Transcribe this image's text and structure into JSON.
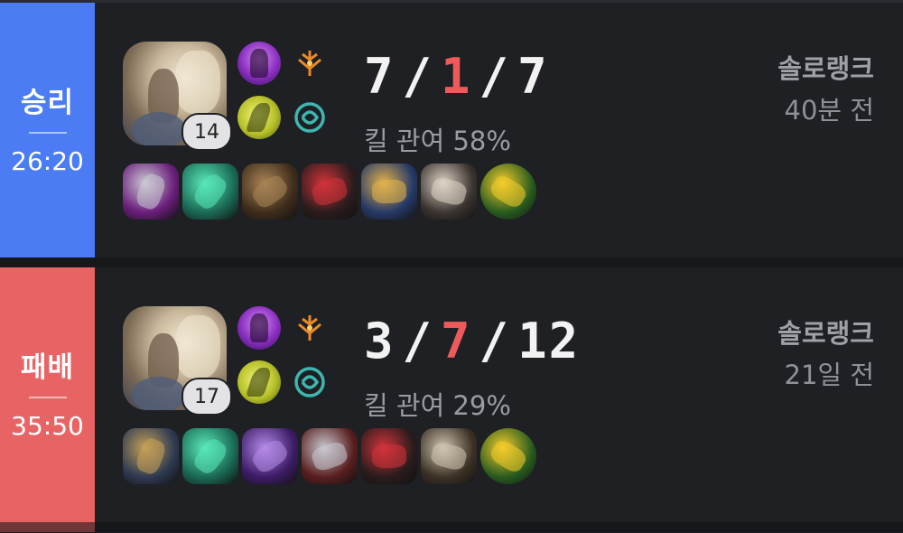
{
  "matches": [
    {
      "result": "승리",
      "duration": "26:20",
      "result_color": "#4b7cf3",
      "champion_level": "14",
      "kda": {
        "kills": "7",
        "deaths": "1",
        "assists": "7"
      },
      "kill_participation": "킬 관여 58%",
      "queue": "솔로랭크",
      "time_ago": "40분 전",
      "spells": [
        "ghost-spell-icon",
        "ignite-spell-icon"
      ],
      "runes": [
        "precision-keystone-icon",
        "sorcery-secondary-icon"
      ],
      "items": [
        {
          "name": "dagger-item-icon",
          "color": "#6a1e7a",
          "accent": "#c9c9d2"
        },
        {
          "name": "potion-item-icon",
          "color": "#1b6a55",
          "accent": "#58e8b8"
        },
        {
          "name": "boots-item-icon",
          "color": "#3f2d1c",
          "accent": "#a98555"
        },
        {
          "name": "black-cleaver-item-icon",
          "color": "#2a1c1c",
          "accent": "#d1333a"
        },
        {
          "name": "spear-item-icon",
          "color": "#263a68",
          "accent": "#e2b24a"
        },
        {
          "name": "armor-item-icon",
          "color": "#3b3430",
          "accent": "#ddd3c5"
        },
        {
          "name": "oracle-lens-trinket-icon",
          "color": "#275a1f",
          "accent": "#f3cc2a"
        }
      ]
    },
    {
      "result": "패배",
      "duration": "35:50",
      "result_color": "#e86464",
      "champion_level": "17",
      "kda": {
        "kills": "3",
        "deaths": "7",
        "assists": "12"
      },
      "kill_participation": "킬 관여 29%",
      "queue": "솔로랭크",
      "time_ago": "21일 전",
      "spells": [
        "ghost-spell-icon",
        "ignite-spell-icon"
      ],
      "runes": [
        "precision-keystone-icon",
        "sorcery-secondary-icon"
      ],
      "items": [
        {
          "name": "drill-item-icon",
          "color": "#2f3a52",
          "accent": "#c4a057"
        },
        {
          "name": "potion-item-icon",
          "color": "#1b6a55",
          "accent": "#58e8b8"
        },
        {
          "name": "sword-item-icon",
          "color": "#3d1c66",
          "accent": "#b48ae8"
        },
        {
          "name": "steel-boots-item-icon",
          "color": "#5a1f1f",
          "accent": "#c7c7cf"
        },
        {
          "name": "black-cleaver-item-icon",
          "color": "#2a1c1c",
          "accent": "#d1333a"
        },
        {
          "name": "hammer-item-icon",
          "color": "#3c3226",
          "accent": "#cfc4b0"
        },
        {
          "name": "oracle-lens-trinket-icon",
          "color": "#275a1f",
          "accent": "#f3cc2a"
        }
      ]
    }
  ]
}
